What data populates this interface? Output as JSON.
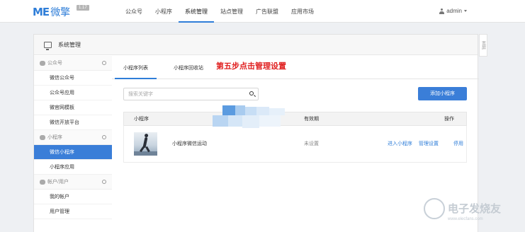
{
  "topbar": {
    "logo_mark": "ME",
    "logo_cn": "微擎",
    "version": "1.17",
    "nav": [
      "公众号",
      "小程序",
      "系统管理",
      "站点管理",
      "广告联盟",
      "应用市场"
    ],
    "active_nav": "系统管理",
    "user": "admin"
  },
  "card": {
    "title": "系统管理",
    "side_tab": "宽屏"
  },
  "sidebar": {
    "sections": [
      {
        "title": "公众号",
        "items": [
          "微信公众号",
          "公众号应用",
          "微官网模板",
          "微信开放平台"
        ]
      },
      {
        "title": "小程序",
        "items": [
          "微信小程序",
          "小程序应用"
        ]
      },
      {
        "title": "帐户/用户",
        "items": [
          "我的帐户",
          "用户管理"
        ]
      }
    ],
    "active_item": "微信小程序"
  },
  "content": {
    "tabs": [
      "小程序列表",
      "小程序回收站"
    ],
    "active_tab": "小程序列表",
    "annotation": "第五步点击管理设置",
    "search": {
      "placeholder": "搜索关键字",
      "value": ""
    },
    "add_button": "添加小程序",
    "table": {
      "headers": [
        "小程序",
        "有效期",
        "操作"
      ],
      "rows": [
        {
          "name": "小程序微信运动",
          "expiry": "未设置",
          "actions": [
            "进入小程序",
            "管理设置",
            "停用"
          ]
        }
      ]
    }
  },
  "watermark": {
    "text": "电子发烧友",
    "url": "www.elecfans.com"
  },
  "colors": {
    "accent": "#2f7ed8",
    "annotation": "#e02020",
    "page_bg": "#eef0f3"
  }
}
